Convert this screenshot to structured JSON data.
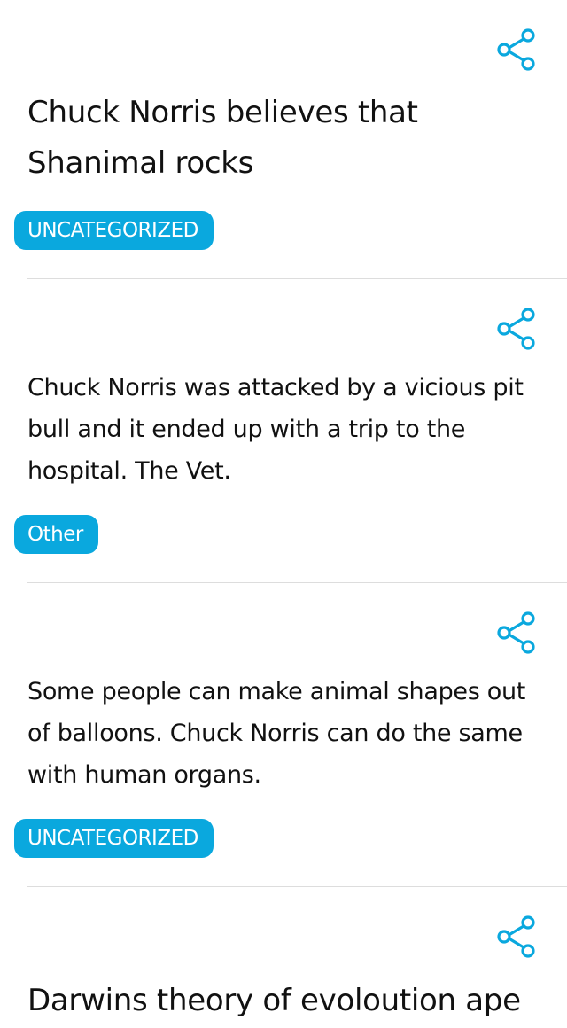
{
  "jokes": [
    {
      "text": "Chuck Norris believes that Shanimal rocks",
      "category": "UNCATEGORIZED",
      "share_icon": "share-icon"
    },
    {
      "text": "Chuck Norris was attacked by a vicious pit bull and it ended up with a trip to the hospital. The Vet.",
      "category": "Other",
      "share_icon": "share-icon"
    },
    {
      "text": "Some people can make animal shapes out of balloons. Chuck Norris can do the same with human organs.",
      "category": "UNCATEGORIZED",
      "share_icon": "share-icon"
    },
    {
      "text": "Darwins theory of evoloution ape",
      "category": "",
      "share_icon": "share-icon"
    }
  ],
  "colors": {
    "tag_background": "#0aa8de",
    "tag_text": "#ffffff",
    "share_icon": "#0aa8de",
    "divider": "#dddddd"
  }
}
